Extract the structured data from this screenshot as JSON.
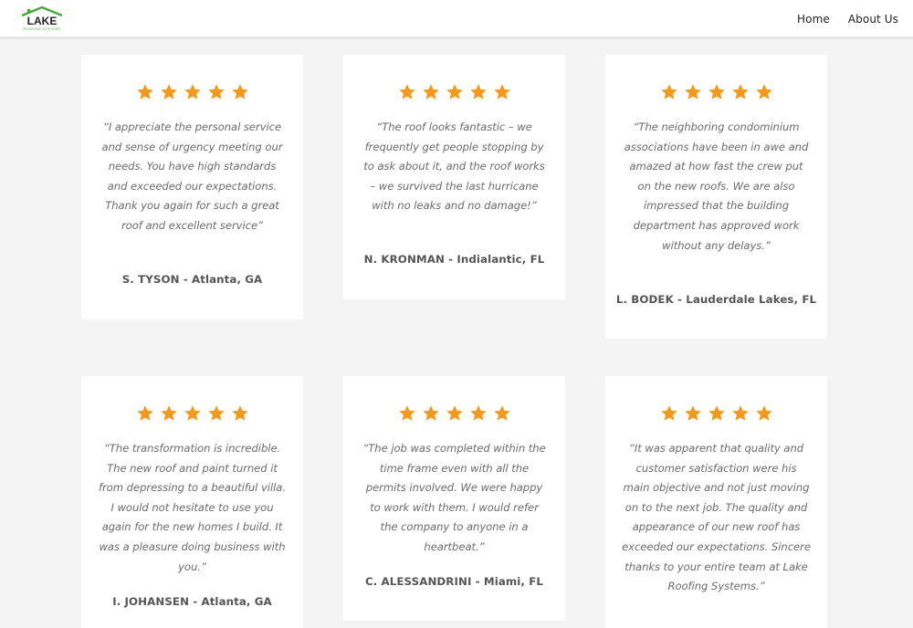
{
  "header": {
    "logo_text": "LAKE",
    "logo_subtext": "ROOFING SYSTEMS",
    "nav": [
      {
        "label": "Home"
      },
      {
        "label": "About Us"
      }
    ]
  },
  "colors": {
    "star": "#f39a1e",
    "logo_green": "#4aa63c",
    "text_quote": "#6b6b6b",
    "text_author": "#555555"
  },
  "testimonials": [
    {
      "rating": 5,
      "quote": "“I appreciate the personal service and sense of urgency meeting our needs. You have high standards and exceeded our expectations. Thank you again for such a great roof and excellent service”",
      "author": "S. TYSON - Atlanta, GA"
    },
    {
      "rating": 5,
      "quote": "“The roof looks fantastic –  we frequently get people stopping by to ask about it, and the roof works – we survived the last hurricane with no leaks and no damage!”",
      "author": "N. KRONMAN - Indialantic, FL"
    },
    {
      "rating": 5,
      "quote": "“The neighboring condominium associations have been in awe and amazed at how fast the crew put on the new roofs. We are also impressed that the building department has approved work without any delays.”",
      "author": "L. BODEK - Lauderdale Lakes, FL"
    },
    {
      "rating": 5,
      "quote": "“The transformation is incredible. The new roof and paint turned it from depressing to a beautiful villa. I would not hesitate to use you again for the new homes I build. It was a pleasure doing business with you.”",
      "author": "I. JOHANSEN - Atlanta, GA"
    },
    {
      "rating": 5,
      "quote": "“The job was completed within the time frame even with all the permits involved. We were happy to work with them. I would refer the company to anyone in a heartbeat.”",
      "author": "C. ALESSANDRINI - Miami, FL"
    },
    {
      "rating": 5,
      "quote": "“It was apparent that quality and customer satisfaction were his main objective and not just moving on to the next job. The quality and appearance of our new roof has exceeded our expectations. Sincere thanks to your entire team at Lake Roofing Systems.”",
      "author": ""
    }
  ]
}
